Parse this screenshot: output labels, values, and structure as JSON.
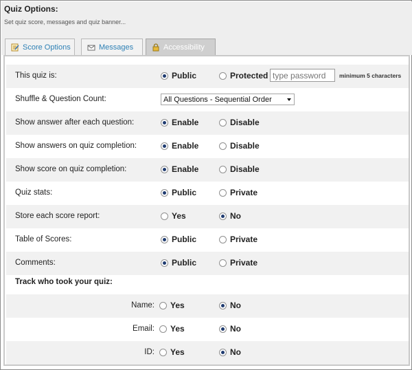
{
  "header": {
    "title": "Quiz Options:",
    "subtitle": "Set quiz score, messages and quiz banner..."
  },
  "tabs": [
    {
      "label": "Score Options",
      "icon": "notepad-icon",
      "active": false
    },
    {
      "label": "Messages",
      "icon": "envelope-icon",
      "active": false
    },
    {
      "label": "Accessibility",
      "icon": "padlock-icon",
      "active": true
    }
  ],
  "rows": {
    "access": {
      "label": "This quiz is:",
      "opt1": "Public",
      "opt2": "Protected",
      "selected": 1,
      "password_placeholder": "type password",
      "password_hint": "minimum 5 characters"
    },
    "shuffle": {
      "label": "Shuffle & Question Count:",
      "selected_value": "All Questions - Sequential Order"
    },
    "show_answer_each": {
      "label": "Show answer after each question:",
      "opt1": "Enable",
      "opt2": "Disable",
      "selected": 1
    },
    "show_answers_completion": {
      "label": "Show answers on quiz completion:",
      "opt1": "Enable",
      "opt2": "Disable",
      "selected": 1
    },
    "show_score_completion": {
      "label": "Show score on quiz completion:",
      "opt1": "Enable",
      "opt2": "Disable",
      "selected": 1
    },
    "quiz_stats": {
      "label": "Quiz stats:",
      "opt1": "Public",
      "opt2": "Private",
      "selected": 1
    },
    "store_report": {
      "label": "Store each score report:",
      "opt1": "Yes",
      "opt2": "No",
      "selected": 2
    },
    "table_scores": {
      "label": "Table of Scores:",
      "opt1": "Public",
      "opt2": "Private",
      "selected": 1
    },
    "comments": {
      "label": "Comments:",
      "opt1": "Public",
      "opt2": "Private",
      "selected": 1
    },
    "track_heading": "Track who took your quiz:",
    "track_name": {
      "label": "Name:",
      "opt1": "Yes",
      "opt2": "No",
      "selected": 2
    },
    "track_email": {
      "label": "Email:",
      "opt1": "Yes",
      "opt2": "No",
      "selected": 2
    },
    "track_id": {
      "label": "ID:",
      "opt1": "Yes",
      "opt2": "No",
      "selected": 2
    }
  },
  "colors": {
    "tab_text": "#2e80b5",
    "radio_fill": "#1f3b70",
    "row_shade": "#f1f1f1"
  }
}
